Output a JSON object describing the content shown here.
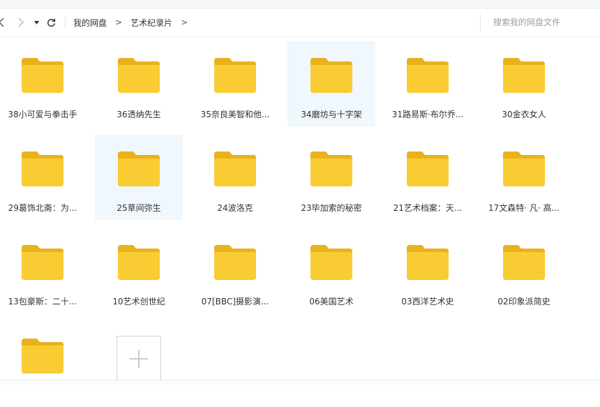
{
  "breadcrumb": {
    "root": "我的网盘",
    "current": "艺术纪录片",
    "separator": ">"
  },
  "search": {
    "placeholder": "搜索我的网盘文件"
  },
  "icons": {
    "back": "chevron-left-icon",
    "forward": "chevron-right-icon",
    "dropdown": "caret-down-icon",
    "refresh": "refresh-icon",
    "folder": "folder-icon",
    "add": "plus-icon"
  },
  "colors": {
    "folder_body": "#F9CC33",
    "folder_tab": "#E9B21C",
    "selected_bg": "#F0F7FD"
  },
  "folders": [
    {
      "name": "38小可爱与拳击手",
      "selected": false
    },
    {
      "name": "36透纳先生",
      "selected": false
    },
    {
      "name": "35奈良美智和他...",
      "selected": false
    },
    {
      "name": "34磨坊与十字架",
      "selected": true
    },
    {
      "name": "31路易斯·布尔乔...",
      "selected": false
    },
    {
      "name": "30金衣女人",
      "selected": false
    },
    {
      "name": "29葛饰北斋：为...",
      "selected": false
    },
    {
      "name": "25草间弥生",
      "selected": true
    },
    {
      "name": "24波洛克",
      "selected": false
    },
    {
      "name": "23毕加索的秘密",
      "selected": false
    },
    {
      "name": "21艺术档案：天...",
      "selected": false
    },
    {
      "name": "17文森特· 凡· 高...",
      "selected": false
    },
    {
      "name": "13包豪斯：二十...",
      "selected": false
    },
    {
      "name": "10艺术创世纪",
      "selected": false
    },
    {
      "name": "07[BBC]摄影演...",
      "selected": false
    },
    {
      "name": "06美国艺术",
      "selected": false
    },
    {
      "name": "03西洋艺术史",
      "selected": false
    },
    {
      "name": "02印象派简史",
      "selected": false
    },
    {
      "name": "",
      "selected": false
    }
  ]
}
